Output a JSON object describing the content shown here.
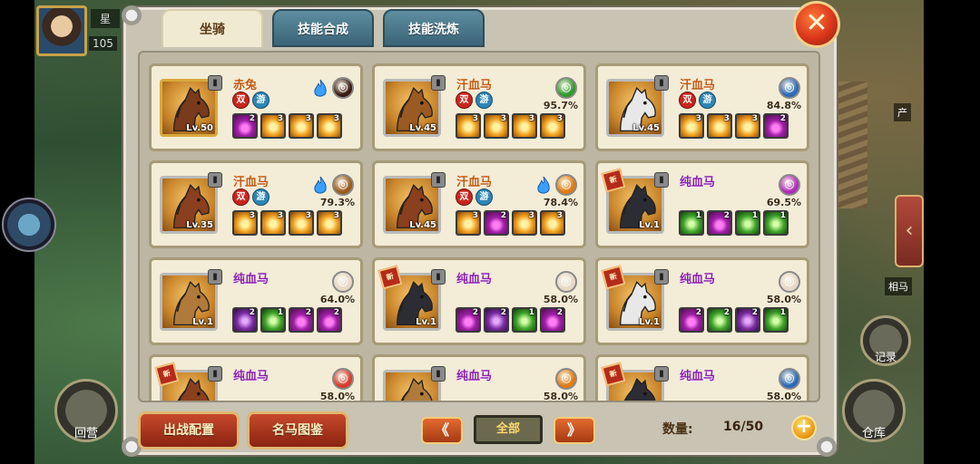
{
  "hud": {
    "player_name": "星",
    "player_level": "105",
    "left_buttons": {
      "camp": "回营"
    },
    "right_buttons": {
      "record": "记录",
      "storage": "仓库"
    },
    "side_labels": {
      "top": "产",
      "middle": "相马"
    }
  },
  "tabs": [
    {
      "label": "坐骑",
      "active": true
    },
    {
      "label": "技能合成",
      "active": false
    },
    {
      "label": "技能洗炼",
      "active": false
    }
  ],
  "close_label": "✕",
  "mounts": [
    {
      "name": "赤兔",
      "name_color": "orange",
      "level": "Lv.50",
      "pct": "",
      "frame": "gold",
      "coat": "#7a3a1c",
      "locked": true,
      "is_new": false,
      "flags": true,
      "fire": true,
      "emblem_color": "#3a1a10",
      "skills": [
        {
          "lv": "2",
          "c": "magenta"
        },
        {
          "lv": "3",
          "c": "gold"
        },
        {
          "lv": "3",
          "c": "gold"
        },
        {
          "lv": "3",
          "c": "gold"
        }
      ]
    },
    {
      "name": "汗血马",
      "name_color": "orange",
      "level": "Lv.45",
      "pct": "95.7%",
      "frame": "silver",
      "coat": "#9a5a22",
      "locked": true,
      "is_new": false,
      "flags": true,
      "fire": false,
      "emblem_color": "#2f9a2a",
      "skills": [
        {
          "lv": "3",
          "c": "gold"
        },
        {
          "lv": "3",
          "c": "gold"
        },
        {
          "lv": "3",
          "c": "gold"
        },
        {
          "lv": "3",
          "c": "gold"
        }
      ]
    },
    {
      "name": "汗血马",
      "name_color": "orange",
      "level": "Lv.45",
      "pct": "84.8%",
      "frame": "silver",
      "coat": "#e8e8e8",
      "locked": true,
      "is_new": false,
      "flags": true,
      "fire": false,
      "emblem_color": "#2a6ab8",
      "skills": [
        {
          "lv": "3",
          "c": "gold"
        },
        {
          "lv": "3",
          "c": "gold"
        },
        {
          "lv": "3",
          "c": "gold"
        },
        {
          "lv": "2",
          "c": "magenta"
        }
      ]
    },
    {
      "name": "汗血马",
      "name_color": "orange",
      "level": "Lv.35",
      "pct": "79.3%",
      "frame": "silver",
      "coat": "#8a3f1e",
      "locked": true,
      "is_new": false,
      "flags": true,
      "fire": true,
      "emblem_color": "#9a5a1a",
      "skills": [
        {
          "lv": "3",
          "c": "gold"
        },
        {
          "lv": "3",
          "c": "gold"
        },
        {
          "lv": "3",
          "c": "gold"
        },
        {
          "lv": "3",
          "c": "gold"
        }
      ]
    },
    {
      "name": "汗血马",
      "name_color": "orange",
      "level": "Lv.45",
      "pct": "78.4%",
      "frame": "silver",
      "coat": "#8a3f1e",
      "locked": true,
      "is_new": false,
      "flags": true,
      "fire": true,
      "emblem_color": "#e07a10",
      "skills": [
        {
          "lv": "3",
          "c": "gold"
        },
        {
          "lv": "2",
          "c": "magenta"
        },
        {
          "lv": "3",
          "c": "gold"
        },
        {
          "lv": "3",
          "c": "gold"
        }
      ]
    },
    {
      "name": "纯血马",
      "name_color": "purple",
      "level": "Lv.1",
      "pct": "69.5%",
      "frame": "silver",
      "coat": "#2c2c34",
      "locked": true,
      "is_new": true,
      "flags": false,
      "fire": false,
      "emblem_color": "#b02ab8",
      "skills": [
        {
          "lv": "1",
          "c": "green"
        },
        {
          "lv": "2",
          "c": "magenta"
        },
        {
          "lv": "1",
          "c": "green"
        },
        {
          "lv": "1",
          "c": "green"
        }
      ]
    },
    {
      "name": "纯血马",
      "name_color": "purple",
      "level": "Lv.1",
      "pct": "64.0%",
      "frame": "silver",
      "coat": "#b07a3a",
      "locked": true,
      "is_new": false,
      "flags": false,
      "fire": false,
      "emblem_color": "#e8d8c8",
      "skills": [
        {
          "lv": "2",
          "c": "purple"
        },
        {
          "lv": "1",
          "c": "green"
        },
        {
          "lv": "2",
          "c": "magenta"
        },
        {
          "lv": "2",
          "c": "magenta"
        }
      ]
    },
    {
      "name": "纯血马",
      "name_color": "purple",
      "level": "Lv.1",
      "pct": "58.0%",
      "frame": "silver",
      "coat": "#2c2c34",
      "locked": true,
      "is_new": true,
      "flags": false,
      "fire": false,
      "emblem_color": "#e8d8c8",
      "skills": [
        {
          "lv": "2",
          "c": "magenta"
        },
        {
          "lv": "2",
          "c": "purple"
        },
        {
          "lv": "1",
          "c": "green"
        },
        {
          "lv": "2",
          "c": "magenta"
        }
      ]
    },
    {
      "name": "纯血马",
      "name_color": "purple",
      "level": "Lv.1",
      "pct": "58.0%",
      "frame": "silver",
      "coat": "#e8e8e8",
      "locked": true,
      "is_new": true,
      "flags": false,
      "fire": false,
      "emblem_color": "#e8d8c8",
      "skills": [
        {
          "lv": "2",
          "c": "magenta"
        },
        {
          "lv": "2",
          "c": "green"
        },
        {
          "lv": "2",
          "c": "purple"
        },
        {
          "lv": "1",
          "c": "green"
        }
      ]
    },
    {
      "name": "纯血马",
      "name_color": "purple",
      "level": "",
      "pct": "58.0%",
      "frame": "silver",
      "coat": "#8a3f1e",
      "locked": true,
      "is_new": true,
      "flags": false,
      "fire": false,
      "emblem_color": "#d83a2a",
      "skills": []
    },
    {
      "name": "纯血马",
      "name_color": "purple",
      "level": "",
      "pct": "58.0%",
      "frame": "silver",
      "coat": "#b07a3a",
      "locked": true,
      "is_new": false,
      "flags": false,
      "fire": false,
      "emblem_color": "#e07a10",
      "skills": []
    },
    {
      "name": "纯血马",
      "name_color": "purple",
      "level": "",
      "pct": "58.0%",
      "frame": "silver",
      "coat": "#2c2c34",
      "locked": true,
      "is_new": true,
      "flags": false,
      "fire": false,
      "emblem_color": "#2a6ab8",
      "skills": []
    }
  ],
  "flag_labels": {
    "red": "双",
    "blue": "游"
  },
  "new_label": "新",
  "footer": {
    "battle_config": "出战配置",
    "famous_horses": "名马图鉴",
    "prev": "《",
    "next": "》",
    "filter": "全部",
    "count_label": "数量:",
    "count_value": "16/50",
    "add": "+"
  }
}
